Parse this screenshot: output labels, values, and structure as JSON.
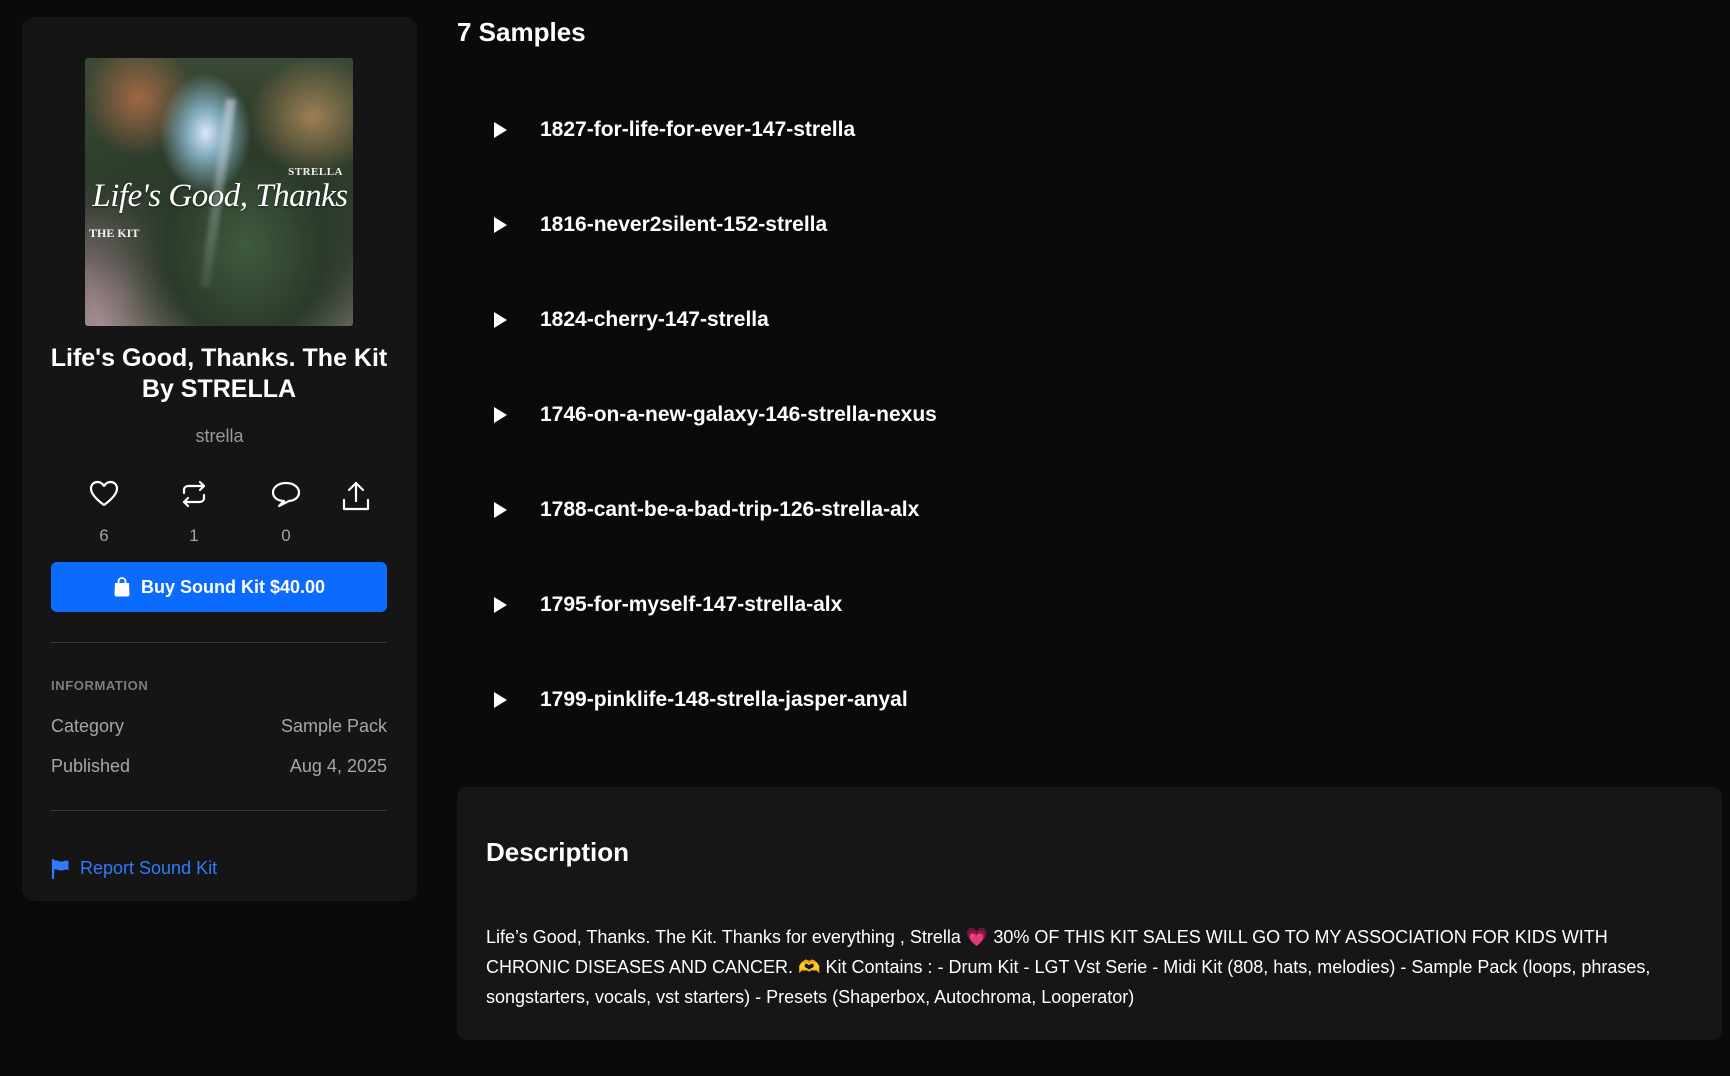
{
  "kit": {
    "title": "Life's Good, Thanks. The Kit By STRELLA",
    "author": "strella",
    "cover": {
      "artist_text": "STRELLA",
      "title_text": "Life's Good, Thanks",
      "subtitle_text": "THE KIT"
    }
  },
  "stats": {
    "likes": "6",
    "reposts": "1",
    "comments": "0"
  },
  "buy_button": {
    "label": "Buy Sound Kit $40.00"
  },
  "information": {
    "heading": "INFORMATION",
    "category_label": "Category",
    "category_value": "Sample Pack",
    "published_label": "Published",
    "published_value": "Aug 4, 2025"
  },
  "report": {
    "label": "Report Sound Kit"
  },
  "samples": {
    "heading": "7 Samples",
    "items": [
      "1827-for-life-for-ever-147-strella",
      "1816-never2silent-152-strella",
      "1824-cherry-147-strella",
      "1746-on-a-new-galaxy-146-strella-nexus",
      "1788-cant-be-a-bad-trip-126-strella-alx",
      "1795-for-myself-147-strella-alx",
      "1799-pinklife-148-strella-jasper-anyal"
    ]
  },
  "description": {
    "heading": "Description",
    "text": "Life’s Good, Thanks. The Kit. Thanks for everything , Strella 💗 30% OF THIS KIT SALES WILL GO TO MY ASSOCIATION FOR KIDS WITH CHRONIC DISEASES AND CANCER. 🫶 Kit Contains : - Drum Kit - LGT Vst Serie - Midi Kit (808, hats, melodies) - Sample Pack (loops, phrases, songstarters, vocals, vst starters) - Presets (Shaperbox, Autochroma, Looperator)"
  },
  "colors": {
    "background": "#0a0a0a",
    "card": "#151515",
    "accent": "#0b6bff",
    "link": "#2f7bff",
    "muted_text": "#a6a6a6"
  },
  "icons": [
    "heart-icon",
    "repost-icon",
    "comment-icon",
    "share-icon",
    "shopping-bag-icon",
    "flag-icon",
    "play-icon"
  ]
}
